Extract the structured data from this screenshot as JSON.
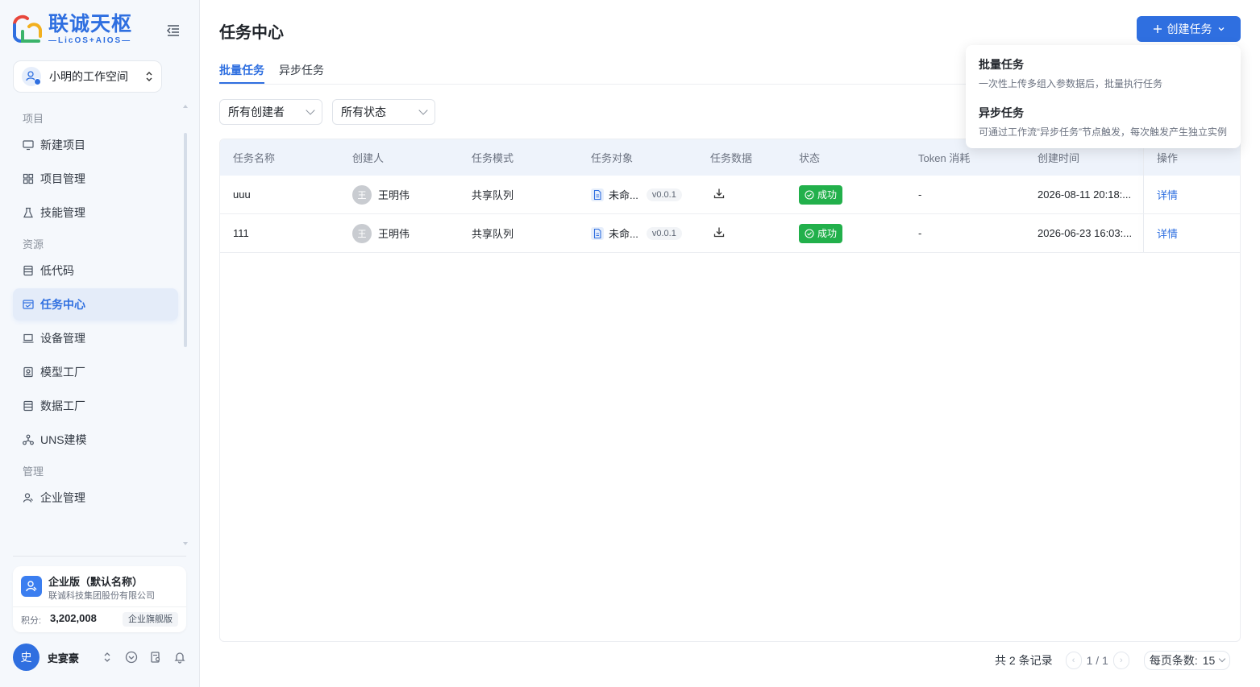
{
  "brand": {
    "title": "联诚天枢",
    "subtitle": "—LicOS+AIOS—"
  },
  "workspace": {
    "name": "小明的工作空间"
  },
  "nav": {
    "group_project": "项目",
    "group_resource": "资源",
    "group_manage": "管理",
    "items": [
      {
        "label": "新建项目",
        "icon": "monitor-icon"
      },
      {
        "label": "项目管理",
        "icon": "grid-icon"
      },
      {
        "label": "技能管理",
        "icon": "flask-icon"
      },
      {
        "label": "低代码",
        "icon": "list-icon"
      },
      {
        "label": "任务中心",
        "icon": "task-icon"
      },
      {
        "label": "设备管理",
        "icon": "laptop-icon"
      },
      {
        "label": "模型工厂",
        "icon": "model-icon"
      },
      {
        "label": "数据工厂",
        "icon": "database-icon"
      },
      {
        "label": "UNS建模",
        "icon": "network-icon"
      },
      {
        "label": "企业管理",
        "icon": "users-icon"
      }
    ]
  },
  "org": {
    "name": "企业版（默认名称）",
    "company": "联诚科技集团股份有限公司",
    "points_label": "积分:",
    "points_value": "3,202,008",
    "edition": "企业旗舰版"
  },
  "user": {
    "avatar": "史",
    "name": "史宴豪"
  },
  "page": {
    "title": "任务中心",
    "create_button": "创建任务"
  },
  "tabs": [
    "批量任务",
    "异步任务"
  ],
  "filters": {
    "creator": "所有创建者",
    "status": "所有状态"
  },
  "table": {
    "headers": [
      "任务名称",
      "创建人",
      "任务模式",
      "任务对象",
      "任务数据",
      "状态",
      "Token 消耗",
      "创建时间",
      "操作"
    ],
    "rows": [
      {
        "name": "uuu",
        "creator_avatar": "王",
        "creator": "王明伟",
        "mode": "共享队列",
        "target": "未命...",
        "version": "v0.0.1",
        "status": "成功",
        "token": "-",
        "created": "2026-08-11 20:18:...",
        "action": "详情"
      },
      {
        "name": "111",
        "creator_avatar": "王",
        "creator": "王明伟",
        "mode": "共享队列",
        "target": "未命...",
        "version": "v0.0.1",
        "status": "成功",
        "token": "-",
        "created": "2026-06-23 16:03:...",
        "action": "详情"
      }
    ]
  },
  "pagination": {
    "total": "共 2 条记录",
    "page": "1 / 1",
    "page_size_label": "每页条数:",
    "page_size": "15"
  },
  "dropdown": {
    "items": [
      {
        "title": "批量任务",
        "desc": "一次性上传多组入参数据后，批量执行任务"
      },
      {
        "title": "异步任务",
        "desc": "可通过工作流“异步任务”节点触发，每次触发产生独立实例"
      }
    ]
  },
  "colors": {
    "accent": "#2f6fe0",
    "success": "#22b04b",
    "sidebar_bg": "#f5f8fc"
  }
}
